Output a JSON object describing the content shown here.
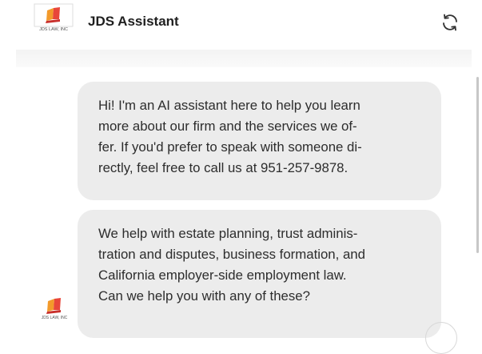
{
  "header": {
    "logo_text": "JDS LAW, INC",
    "title": "JDS Assistant",
    "refresh_icon": "refresh-icon"
  },
  "messages": [
    {
      "lines": [
        "Hi! I'm an AI assistant here to help you learn",
        "more about our firm and the services we of-",
        "fer. If you'd prefer to speak with someone di-",
        "rectly, feel free to call us at 951-257-9878."
      ]
    },
    {
      "lines": [
        "We help with estate planning, trust adminis-",
        "tration and disputes, business formation, and",
        "California employer-side employment law.",
        "Can we help you with any of these?"
      ]
    }
  ],
  "avatar": {
    "logo_text": "JDS LAW, INC"
  },
  "colors": {
    "bubble": "#ececec",
    "logo_orange": "#f39a2b",
    "logo_red": "#e8463a"
  }
}
